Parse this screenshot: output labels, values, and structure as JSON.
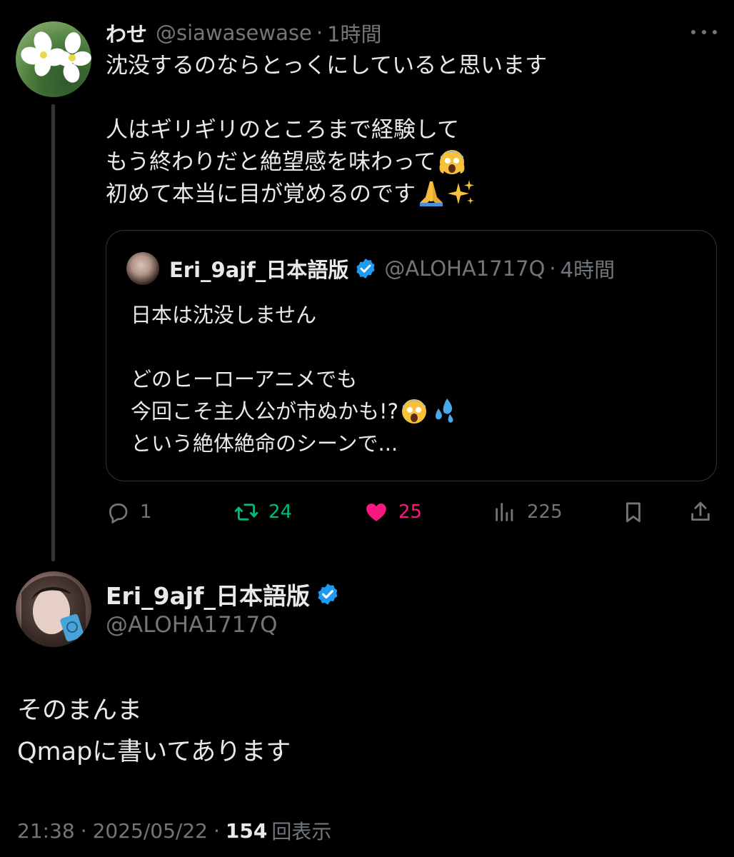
{
  "thread_tweet": {
    "display_name": "わせ",
    "handle": "@siawasewase",
    "separator": "·",
    "time": "1時間",
    "lines": [
      "沈没するのならとっくにしていると思います",
      "",
      "人はギリギリのところまで経験して",
      "もう終わりだと絶望感を味わって",
      "初めて本当に目が覚めるのです"
    ],
    "emojis": [
      "face-screaming-icon",
      "folded-hands-icon",
      "sparkles-icon"
    ]
  },
  "quoted_tweet": {
    "display_name": "Eri_9ajf_日本語版",
    "handle": "@ALOHA1717Q",
    "separator": "·",
    "time": "4時間",
    "lines": [
      "日本は沈没しません",
      "",
      "どのヒーローアニメでも",
      "今回こそ主人公が市ぬかも!?",
      "という絶体絶命のシーンで..."
    ],
    "emojis": [
      "face-screaming-icon",
      "sweat-droplets-icon"
    ]
  },
  "actions": {
    "reply_count": "1",
    "retweet_count": "24",
    "like_count": "25",
    "views_count": "225",
    "colors": {
      "retweet": "#00ba7c",
      "like": "#f91880",
      "muted": "#71767b"
    }
  },
  "main_tweet": {
    "display_name": "Eri_9ajf_日本語版",
    "handle": "@ALOHA1717Q",
    "lines": [
      "そのまんま",
      "Qmapに書いてあります"
    ],
    "time": "21:38",
    "sep1": "·",
    "date": "2025/05/22",
    "sep2": "·",
    "views": "154",
    "views_label": "回表示"
  },
  "verified_color": "#1d9bf0"
}
